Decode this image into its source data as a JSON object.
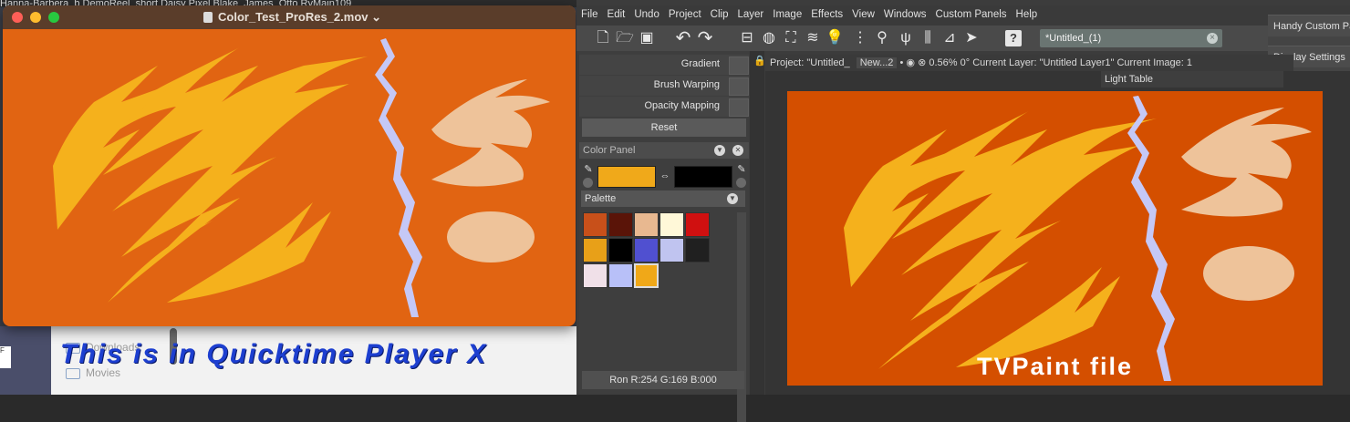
{
  "desktop": {
    "menubar_text": "Hanna-Barbera_b  DemoReel_short     Daisy Pixel   Blake_James_Otto   RyMain109",
    "finder_items": [
      "Downloads",
      "Movies"
    ]
  },
  "quicktime": {
    "title": "Color_Test_ProRes_2.mov",
    "title_chevron": "⌄",
    "overlay_caption": "This is in Quicktime Player X"
  },
  "tvpaint": {
    "menus": [
      "File",
      "Edit",
      "Undo",
      "Project",
      "Clip",
      "Layer",
      "Image",
      "Effects",
      "View",
      "Windows",
      "Custom Panels",
      "Help"
    ],
    "document_field": "*Untitled_(1)",
    "right_panel": [
      "Handy Custom Pa",
      "Display Settings"
    ],
    "tool_settings": [
      {
        "label": "Gradient"
      },
      {
        "label": "Brush Warping"
      },
      {
        "label": "Opacity Mapping"
      }
    ],
    "reset_label": "Reset",
    "color_panel_title": "Color Panel",
    "palette_title": "Palette",
    "palette_swatches": [
      "#c8501a",
      "#5a1408",
      "#e8b890",
      "#fff8d8",
      "#d01010",
      "#e8a018",
      "#000000",
      "#5050d0",
      "#c0c4f0",
      "#202020",
      "#f0e0e8",
      "#b8c0f8",
      "#f0a818"
    ],
    "primary_color": "#f0a91a",
    "secondary_color": "#000000",
    "rgb_readout": "Ron R:254 G:169 B:000",
    "info": {
      "project": "Project:  \"Untitled_",
      "tab": "New...2",
      "zoom": "0.56%",
      "angle": "0°",
      "current_layer": "Current Layer: \"Untitled Layer1\"",
      "current_image": "Current Image: 1"
    },
    "light_table": "Light Table",
    "canvas_label": "TVPaint file",
    "canvas_color": "#d44f00"
  },
  "artwork": {
    "background_quicktime": "#e16412",
    "yellow": "#f5b11c",
    "peach": "#eec39a",
    "lilac": "#c5c8f6"
  }
}
